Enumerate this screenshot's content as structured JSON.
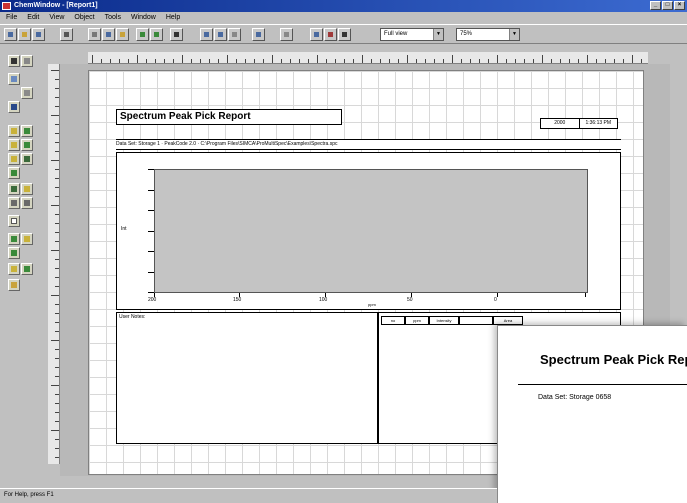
{
  "window": {
    "title": "ChemWindow - [Report1]"
  },
  "menu": [
    "File",
    "Edit",
    "View",
    "Object",
    "Tools",
    "Window",
    "Help"
  ],
  "toolbar": {
    "zoom_combo": "Full view",
    "percent_combo": "75%"
  },
  "report": {
    "title": "Spectrum Peak Pick Report",
    "date": "2000",
    "time": "1:36:13 PM",
    "dataset_line": "Data Set: Storage 1 · PeakCode 2.0 · C:\\Program Files\\SIMCA\\ProMultiSpec\\Examples\\Spectra.spc",
    "y_axis_label": "Int",
    "x_axis_label": "ppm",
    "x_ticks": [
      "200",
      "150",
      "100",
      "50",
      "0"
    ],
    "notes_label": "User Notes:",
    "peak_columns": [
      "no",
      "ppm",
      "Intensity",
      "",
      "Area"
    ]
  },
  "inset": {
    "title": "Spectrum Peak Pick Report",
    "dataset_label": "Data Set: Storage 0658"
  },
  "status": {
    "text": "For Help, press F1"
  }
}
